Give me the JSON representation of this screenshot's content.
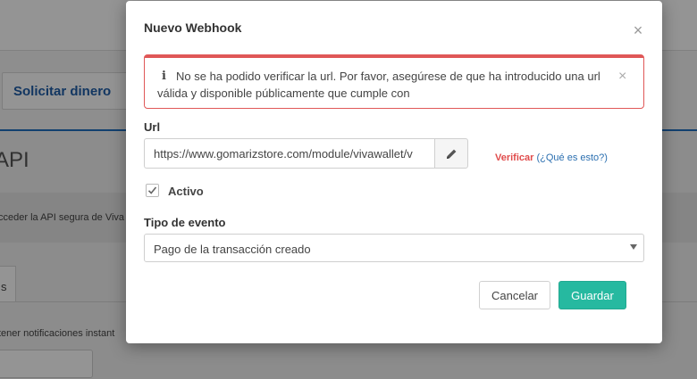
{
  "background": {
    "request_money_label": "Solicitar dinero",
    "heading": "API",
    "info_text": "cceder la API segura de Viva",
    "tab_fragment": "s",
    "notifications_text": "tener notificaciones instant"
  },
  "modal": {
    "title": "Nuevo Webhook",
    "alert": {
      "icon": "info-icon",
      "text": "No se ha podido verificar la url. Por favor, asegúrese de que ha introducido una url válida y disponible públicamente que cumple con"
    },
    "url": {
      "label": "Url",
      "value": "https://www.gomarizstore.com/module/vivawallet/v",
      "verify_label": "Verificar",
      "whatis_label": "(¿Qué es esto?)"
    },
    "active": {
      "label": "Activo",
      "checked": true
    },
    "event_type": {
      "label": "Tipo de evento",
      "selected": "Pago de la transacción creado"
    },
    "buttons": {
      "cancel": "Cancelar",
      "save": "Guardar"
    }
  },
  "colors": {
    "accent": "#26b9a0",
    "error": "#e05757",
    "link": "#2b6fb0",
    "brand_blue": "#1f5ea8"
  }
}
